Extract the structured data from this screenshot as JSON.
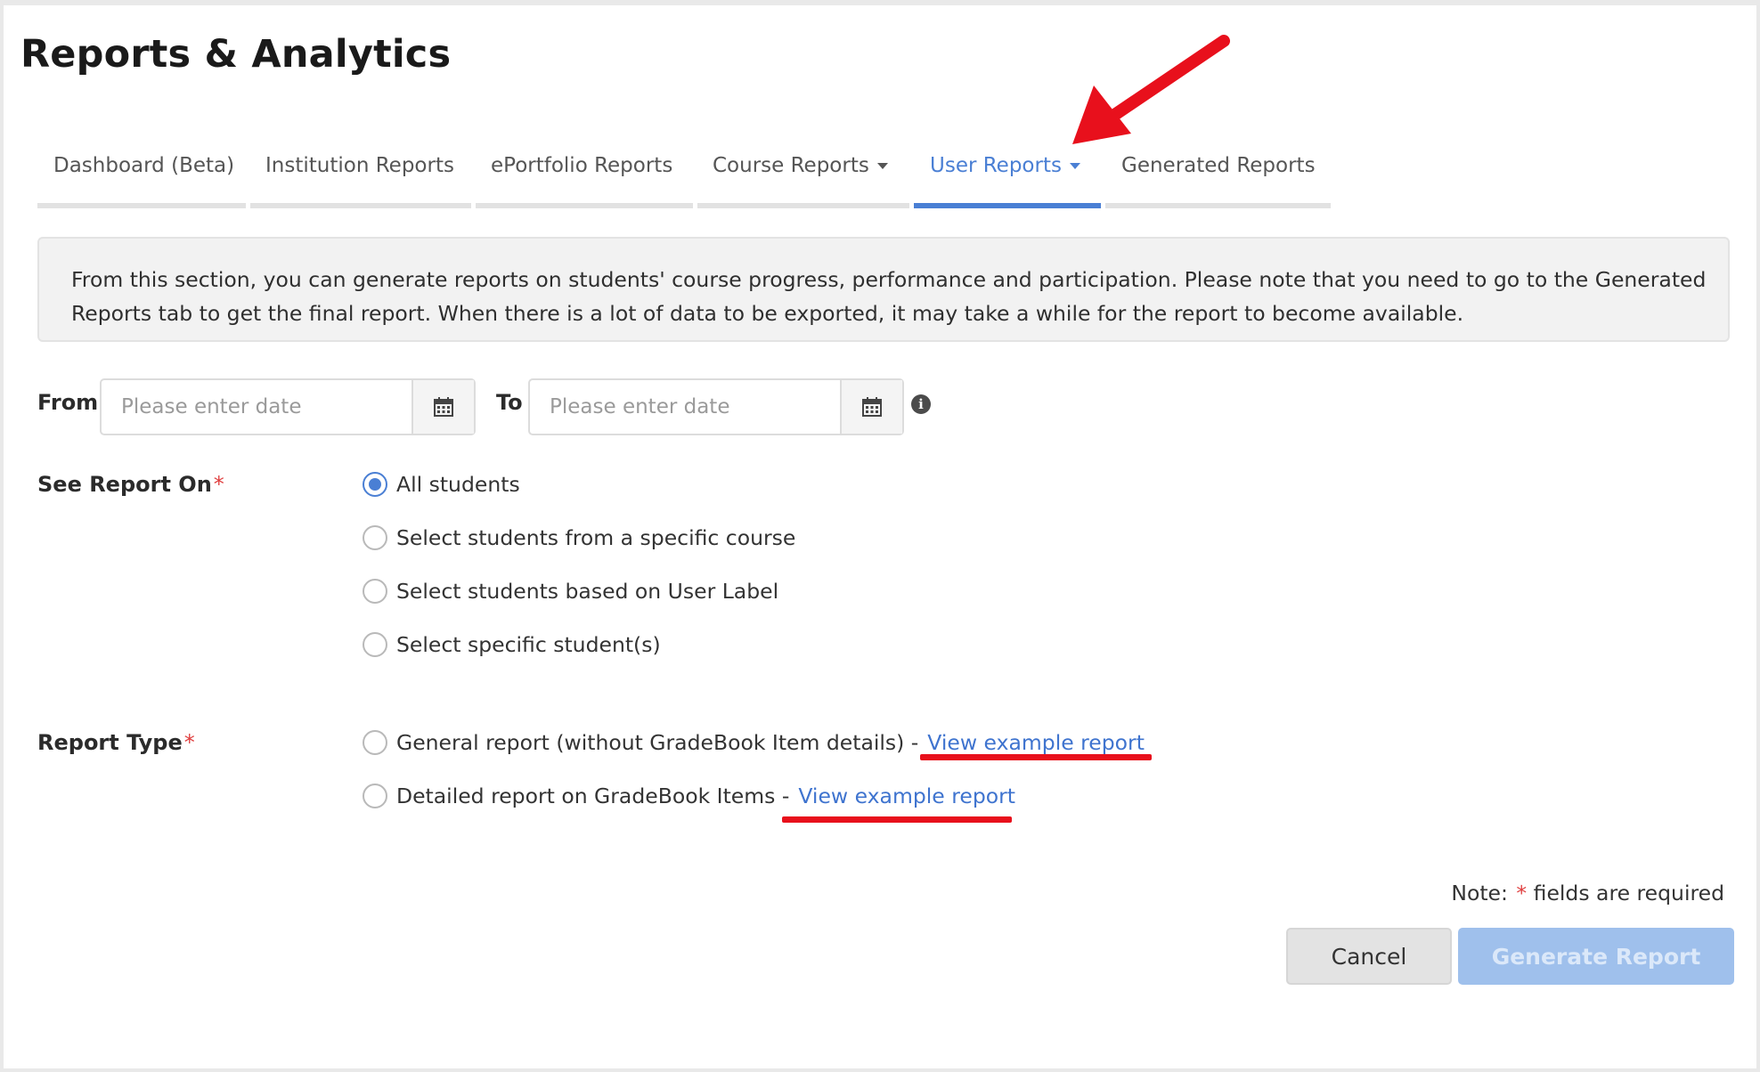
{
  "header": {
    "title": "Reports & Analytics"
  },
  "tabs": [
    {
      "label": "Dashboard (Beta)",
      "active": false,
      "dropdown": false
    },
    {
      "label": "Institution Reports",
      "active": false,
      "dropdown": false
    },
    {
      "label": "ePortfolio Reports",
      "active": false,
      "dropdown": false
    },
    {
      "label": "Course Reports",
      "active": false,
      "dropdown": true
    },
    {
      "label": "User Reports",
      "active": true,
      "dropdown": true
    },
    {
      "label": "Generated Reports",
      "active": false,
      "dropdown": false
    }
  ],
  "info": {
    "text_line1": "From this section, you can generate reports on students' course progress, performance and participation. Please note that you need to go to the Generated",
    "text_line2": "Reports tab to get the final report. When there is a lot of data to be exported, it may take a while for the report to become available."
  },
  "date_range": {
    "from_label": "From",
    "from_placeholder": "Please enter date",
    "to_label": "To",
    "to_placeholder": "Please enter date",
    "calendar_icon": "calendar-icon",
    "info_icon": "info-icon",
    "info_glyph": "i"
  },
  "see_report_on": {
    "label": "See Report On",
    "required_mark": "*",
    "options": [
      {
        "label": "All students",
        "checked": true
      },
      {
        "label": "Select students from a specific course",
        "checked": false
      },
      {
        "label": "Select students based on User Label",
        "checked": false
      },
      {
        "label": "Select specific student(s)",
        "checked": false
      }
    ]
  },
  "report_type": {
    "label": "Report Type",
    "required_mark": "*",
    "options": [
      {
        "label": "General report (without GradeBook Item details) -",
        "link": "View example report",
        "checked": false
      },
      {
        "label": "Detailed report on GradeBook Items -",
        "link": "View example report",
        "checked": false
      }
    ]
  },
  "footer": {
    "note_prefix": "Note:",
    "note_mark": "*",
    "note_suffix": "fields are required",
    "cancel_label": "Cancel",
    "generate_label": "Generate Report"
  },
  "colors": {
    "accent": "#4a7fd4",
    "link": "#3f74cf",
    "annotation_red": "#e8101c",
    "generate_disabled_bg": "#9fc0ec"
  }
}
